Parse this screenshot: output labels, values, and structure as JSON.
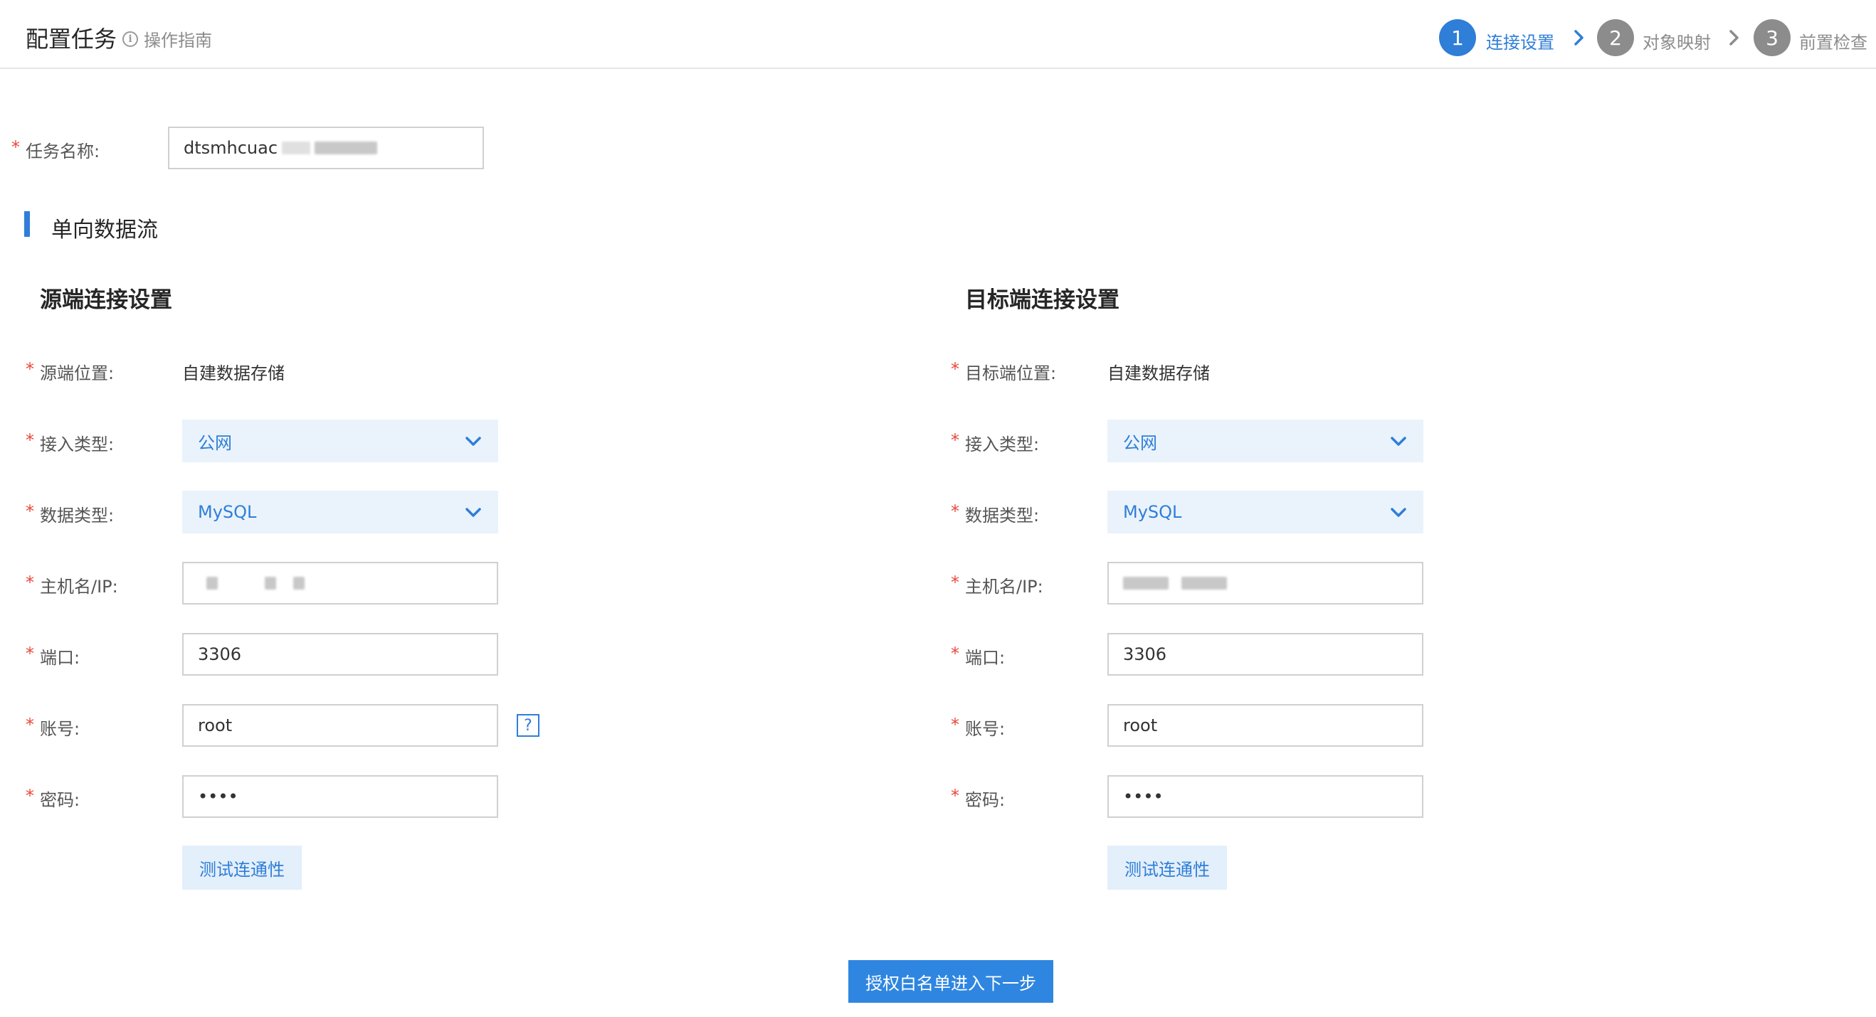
{
  "header": {
    "title": "配置任务",
    "guide_label": "操作指南",
    "steps": [
      {
        "number": "1",
        "label": "连接设置",
        "state": "active"
      },
      {
        "number": "2",
        "label": "对象映射",
        "state": "inactive"
      },
      {
        "number": "3",
        "label": "前置检查",
        "state": "inactive"
      }
    ]
  },
  "task": {
    "name_label": "任务名称:",
    "name_value": "dtsmhcuac"
  },
  "section": {
    "title": "单向数据流"
  },
  "source": {
    "title": "源端连接设置",
    "location_label": "源端位置:",
    "location_value": "自建数据存储",
    "access_type_label": "接入类型:",
    "access_type_value": "公网",
    "db_type_label": "数据类型:",
    "db_type_value": "MySQL",
    "host_label": "主机名/IP:",
    "port_label": "端口:",
    "port_value": "3306",
    "account_label": "账号:",
    "account_value": "root",
    "password_label": "密码:",
    "password_value": "••••",
    "help_symbol": "?",
    "test_button": "测试连通性"
  },
  "target": {
    "title": "目标端连接设置",
    "location_label": "目标端位置:",
    "location_value": "自建数据存储",
    "access_type_label": "接入类型:",
    "access_type_value": "公网",
    "db_type_label": "数据类型:",
    "db_type_value": "MySQL",
    "host_label": "主机名/IP:",
    "port_label": "端口:",
    "port_value": "3306",
    "account_label": "账号:",
    "account_value": "root",
    "password_label": "密码:",
    "password_value": "••••",
    "test_button": "测试连通性"
  },
  "footer": {
    "next_button": "授权白名单进入下一步"
  },
  "colors": {
    "accent": "#2f7ed8",
    "step_inactive": "#8c8c8c",
    "required": "#e8483b"
  }
}
